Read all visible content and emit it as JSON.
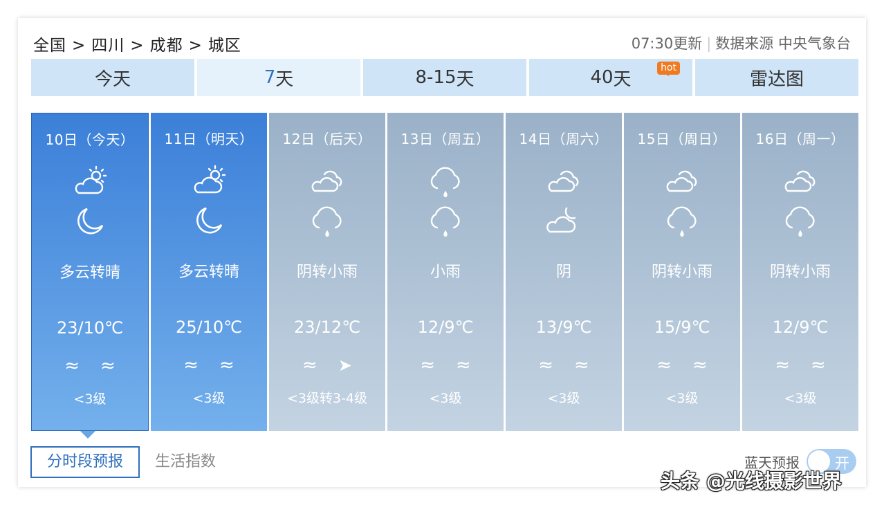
{
  "breadcrumb": {
    "items": [
      "全国",
      "四川",
      "成都",
      "城区"
    ],
    "separator": ">"
  },
  "source": {
    "update_time": "07:30更新",
    "source_label": "数据来源 中央气象台"
  },
  "tabs": [
    {
      "label_num": "",
      "label_text": "今天"
    },
    {
      "label_num": "7",
      "label_text": "天"
    },
    {
      "label_num": "8-15",
      "label_text": "天"
    },
    {
      "label_num": "40",
      "label_text": "天",
      "badge": "hot"
    },
    {
      "label_num": "",
      "label_text": "雷达图"
    }
  ],
  "days": [
    {
      "date": "10日（今天）",
      "day_icon": "partly-cloudy-sun-icon",
      "night_icon": "moon-icon",
      "desc": "多云转晴",
      "temp": "23/10℃",
      "wind_icon1": "≈",
      "wind_icon2": "≈",
      "wind_level": "<3级"
    },
    {
      "date": "11日（明天）",
      "day_icon": "partly-cloudy-sun-icon",
      "night_icon": "moon-icon",
      "desc": "多云转晴",
      "temp": "25/10℃",
      "wind_icon1": "≈",
      "wind_icon2": "≈",
      "wind_level": "<3级"
    },
    {
      "date": "12日（后天）",
      "day_icon": "overcast-icon",
      "night_icon": "light-rain-icon",
      "desc": "阴转小雨",
      "temp": "23/12℃",
      "wind_icon1": "≈",
      "wind_icon2": "➤",
      "wind_level": "<3级转3-4级"
    },
    {
      "date": "13日（周五）",
      "day_icon": "light-rain-icon",
      "night_icon": "light-rain-icon",
      "desc": "小雨",
      "temp": "12/9℃",
      "wind_icon1": "≈",
      "wind_icon2": "≈",
      "wind_level": "<3级"
    },
    {
      "date": "14日（周六）",
      "day_icon": "overcast-icon",
      "night_icon": "cloudy-night-icon",
      "desc": "阴",
      "temp": "13/9℃",
      "wind_icon1": "≈",
      "wind_icon2": "≈",
      "wind_level": "<3级"
    },
    {
      "date": "15日（周日）",
      "day_icon": "overcast-icon",
      "night_icon": "light-rain-icon",
      "desc": "阴转小雨",
      "temp": "15/9℃",
      "wind_icon1": "≈",
      "wind_icon2": "≈",
      "wind_level": "<3级"
    },
    {
      "date": "16日（周一）",
      "day_icon": "overcast-icon",
      "night_icon": "light-rain-icon",
      "desc": "阴转小雨",
      "temp": "12/9℃",
      "wind_icon1": "≈",
      "wind_icon2": "≈",
      "wind_level": "<3级"
    }
  ],
  "bottom_tabs": [
    "分时段预报",
    "生活指数"
  ],
  "blue_sky": {
    "label": "蓝天预报",
    "toggle": "开"
  },
  "watermark": "头条 @光线摄影世界",
  "colors": {
    "active_blue": "#3b7fd8",
    "inactive_gray": "#9ab1c8",
    "tab_bg": "#cfe5f7",
    "hot_badge": "#f07a22"
  }
}
